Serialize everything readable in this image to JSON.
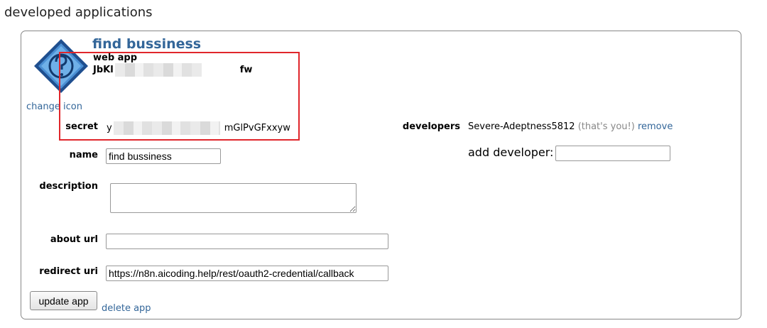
{
  "section_title": "developed applications",
  "app": {
    "name": "find bussiness",
    "type": "web app",
    "client_id_start": "JbKl",
    "client_id_end": "fw",
    "change_icon_label": "change icon",
    "secret_label": "secret",
    "secret_start": "y",
    "secret_end": "mGlPvGFxxyw",
    "name_label": "name",
    "name_value": "find bussiness",
    "description_label": "description",
    "description_value": "",
    "about_url_label": "about url",
    "about_url_value": "",
    "redirect_uri_label": "redirect uri",
    "redirect_uri_value": "https://n8n.aicoding.help/rest/oauth2-credential/callback",
    "update_button": "update app",
    "delete_link": "delete app"
  },
  "developers": {
    "label": "developers",
    "list": [
      {
        "name": "Severe-Adeptness5812",
        "note": "(that's you!)",
        "action": "remove"
      }
    ],
    "add_label": "add developer:",
    "add_value": ""
  },
  "icons": {
    "app_icon": "question-mark-diamond-icon"
  },
  "colors": {
    "link": "#336699",
    "highlight": "#e0262b"
  }
}
